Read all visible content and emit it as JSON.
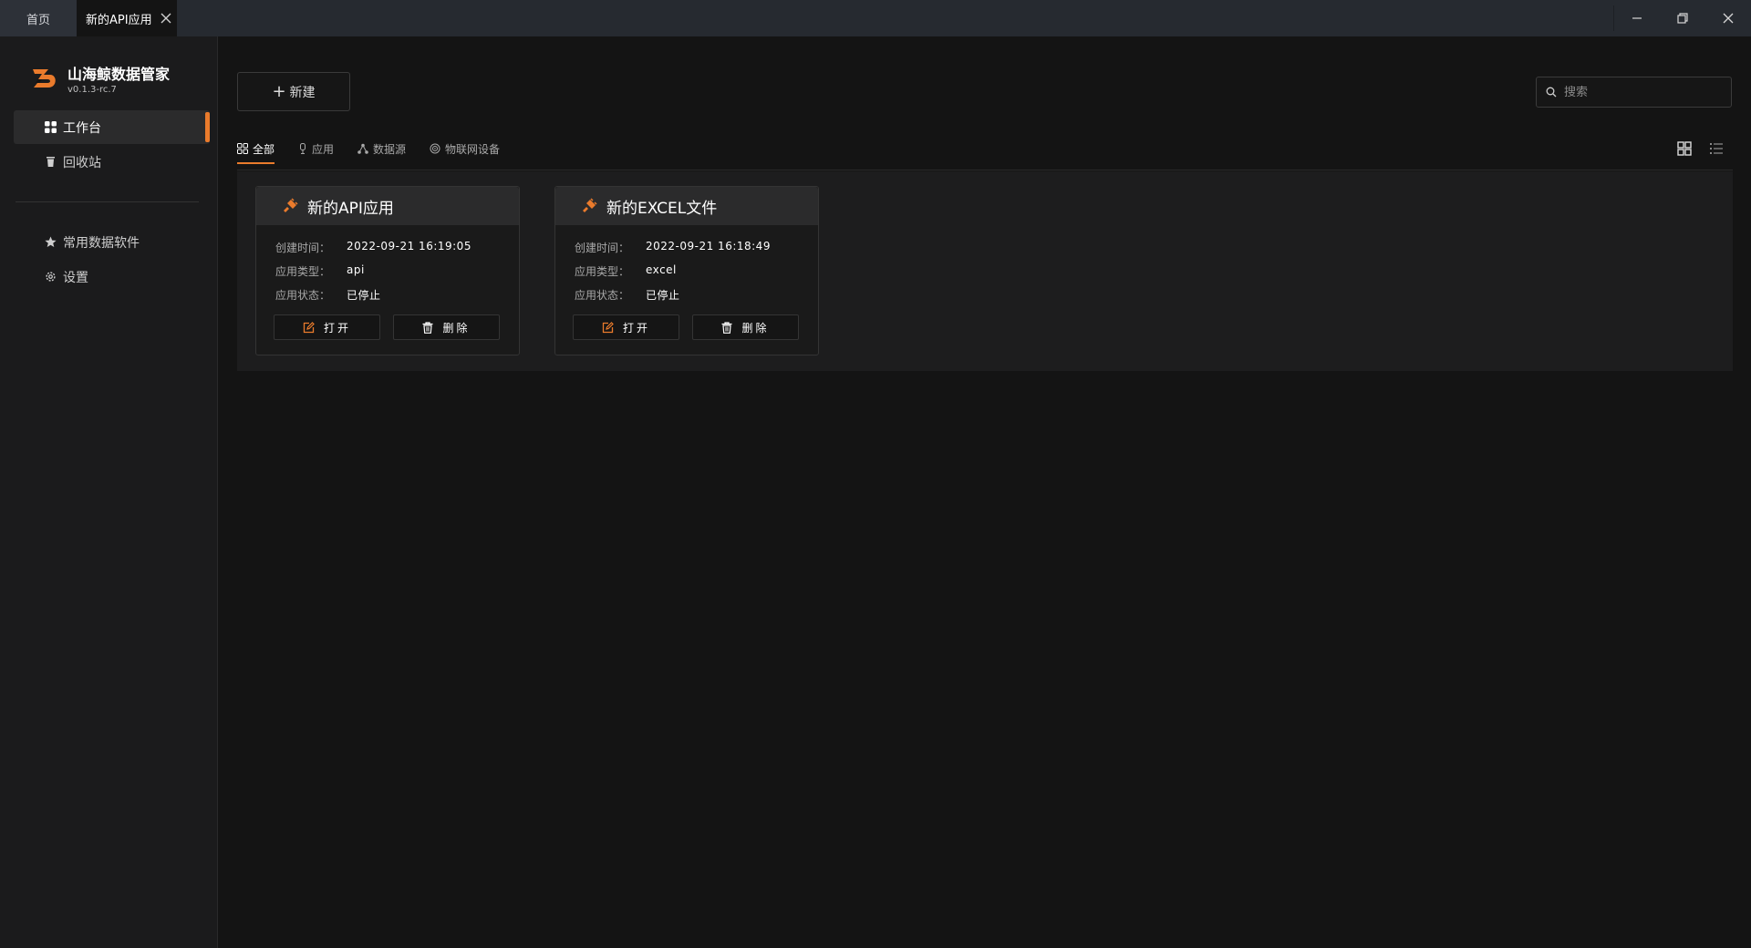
{
  "titlebar": {
    "tabs": [
      {
        "label": "首页"
      },
      {
        "label": "新的API应用"
      }
    ]
  },
  "sidebar": {
    "app_name": "山海鲸数据管家",
    "version": "v0.1.3-rc.7",
    "items": [
      {
        "label": "工作台",
        "icon": "grid-icon",
        "active": true
      },
      {
        "label": "回收站",
        "icon": "trash-icon"
      },
      {
        "label": "常用数据软件",
        "icon": "star-icon"
      },
      {
        "label": "设置",
        "icon": "gear-icon"
      }
    ]
  },
  "toolbar": {
    "new_label": "新建",
    "search_placeholder": "搜索"
  },
  "filter_tabs": [
    {
      "label": "全部",
      "icon": "grid-icon",
      "active": true
    },
    {
      "label": "应用",
      "icon": "app-icon"
    },
    {
      "label": "数据源",
      "icon": "datasource-icon"
    },
    {
      "label": "物联网设备",
      "icon": "iot-icon"
    }
  ],
  "labels": {
    "created": "创建时间：",
    "type": "应用类型：",
    "status": "应用状态："
  },
  "cards": [
    {
      "title": "新的API应用",
      "created": "2022-09-21 16:19:05",
      "type": "api",
      "status": "已停止",
      "open_label": "打开",
      "delete_label": "删除"
    },
    {
      "title": "新的EXCEL文件",
      "created": "2022-09-21 16:18:49",
      "type": "excel",
      "status": "已停止",
      "open_label": "打开",
      "delete_label": "删除"
    }
  ],
  "colors": {
    "accent": "#ea7b2c",
    "background": "#141414",
    "sidebar": "#1b1b1c",
    "titlebar": "#262a30"
  }
}
